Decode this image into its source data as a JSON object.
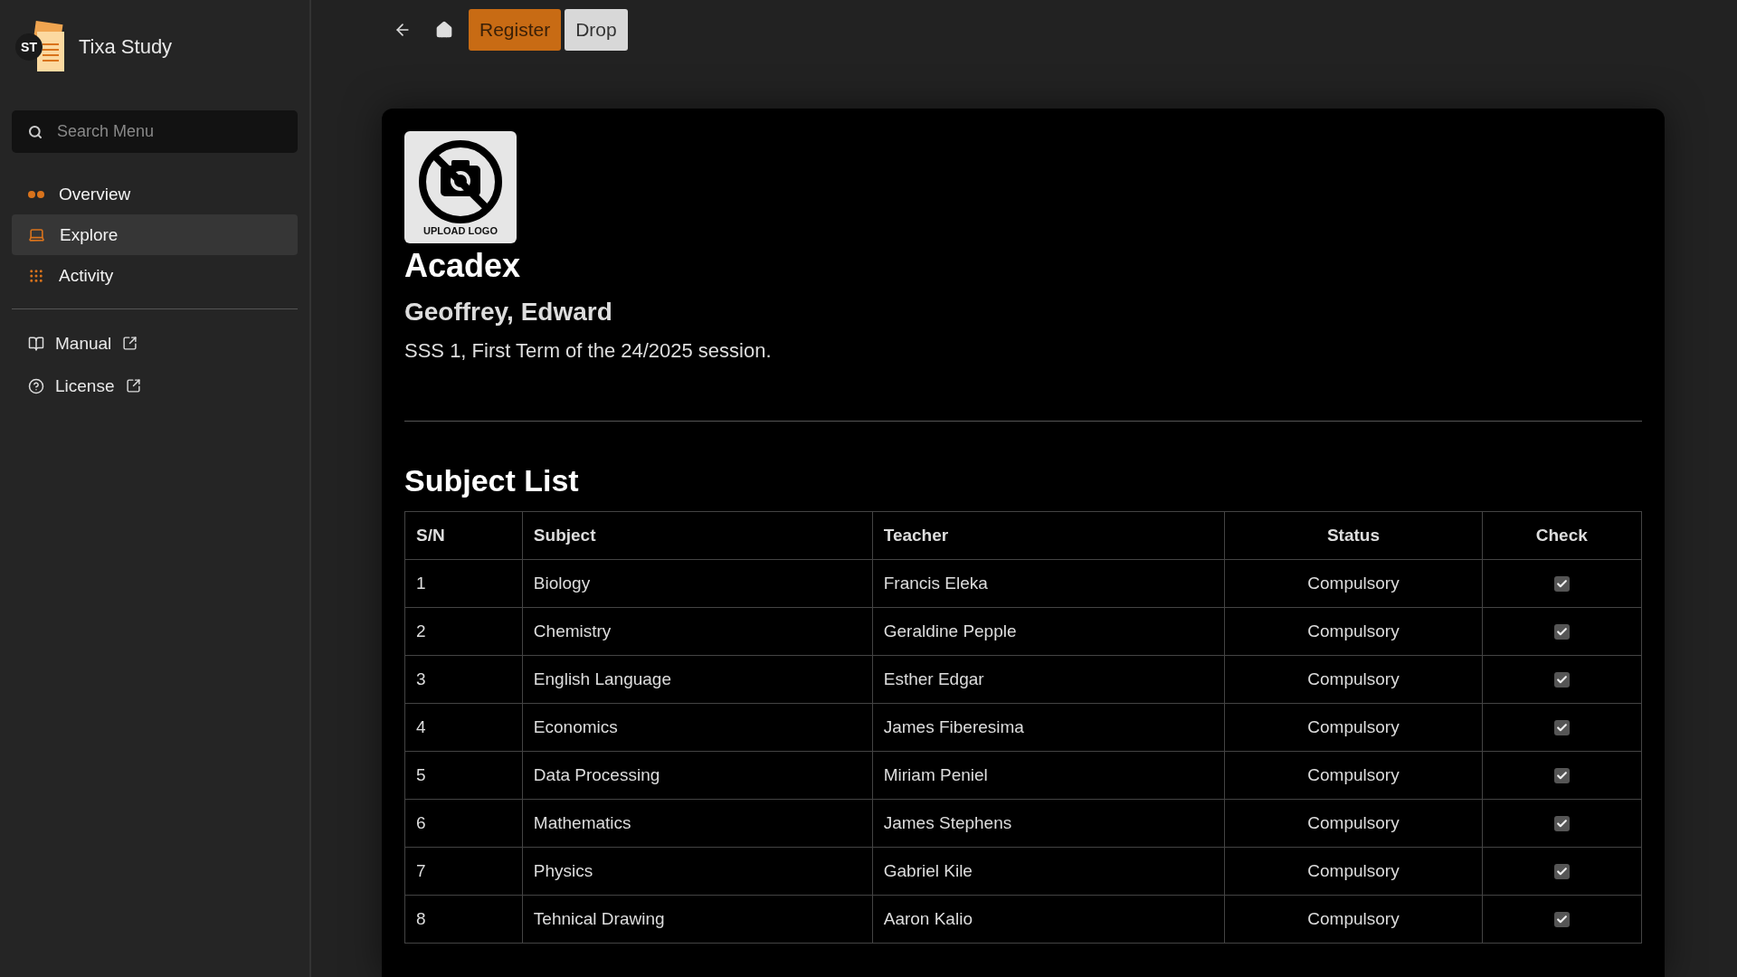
{
  "app": {
    "logo_text": "ST",
    "name": "Tixa Study"
  },
  "search": {
    "placeholder": "Search Menu"
  },
  "menu": [
    {
      "label": "Overview",
      "selected": false
    },
    {
      "label": "Explore",
      "selected": true
    },
    {
      "label": "Activity",
      "selected": false
    }
  ],
  "links": [
    {
      "label": "Manual"
    },
    {
      "label": "License"
    }
  ],
  "toolbar": {
    "buttons": [
      {
        "label": "Register",
        "kind": "primary"
      },
      {
        "label": "Drop",
        "kind": "secondary"
      }
    ]
  },
  "school": {
    "logo_caption": "UPLOAD LOGO",
    "name": "Acadex",
    "student": "Geoffrey, Edward",
    "session": "SSS 1, First Term of the 24/2025 session."
  },
  "subject_list": {
    "title": "Subject List",
    "columns": [
      "S/N",
      "Subject",
      "Teacher",
      "Status",
      "Check"
    ],
    "rows": [
      {
        "sn": "1",
        "subject": "Biology",
        "teacher": "Francis Eleka",
        "status": "Compulsory",
        "checked": true
      },
      {
        "sn": "2",
        "subject": "Chemistry",
        "teacher": "Geraldine Pepple",
        "status": "Compulsory",
        "checked": true
      },
      {
        "sn": "3",
        "subject": "English Language",
        "teacher": "Esther Edgar",
        "status": "Compulsory",
        "checked": true
      },
      {
        "sn": "4",
        "subject": "Economics",
        "teacher": "James Fiberesima",
        "status": "Compulsory",
        "checked": true
      },
      {
        "sn": "5",
        "subject": "Data Processing",
        "teacher": "Miriam Peniel",
        "status": "Compulsory",
        "checked": true
      },
      {
        "sn": "6",
        "subject": "Mathematics",
        "teacher": "James Stephens",
        "status": "Compulsory",
        "checked": true
      },
      {
        "sn": "7",
        "subject": "Physics",
        "teacher": "Gabriel Kile",
        "status": "Compulsory",
        "checked": true
      },
      {
        "sn": "8",
        "subject": "Tehnical Drawing",
        "teacher": "Aaron Kalio",
        "status": "Compulsory",
        "checked": true
      }
    ]
  }
}
